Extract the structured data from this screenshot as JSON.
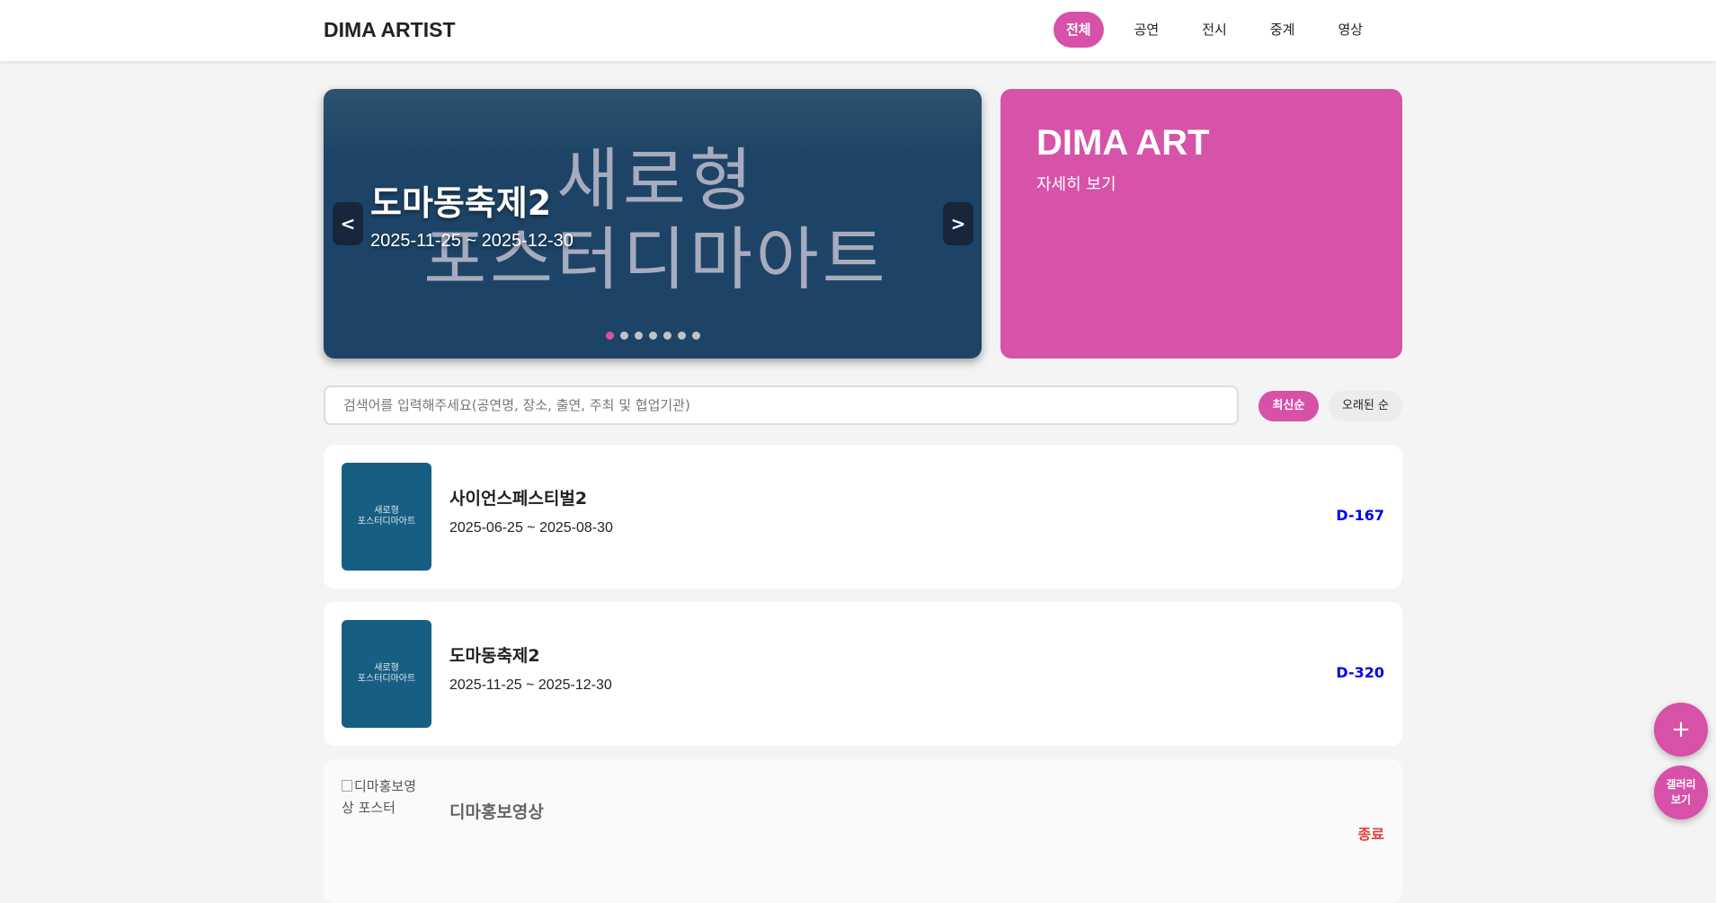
{
  "header": {
    "logo": "DIMA ARTIST",
    "nav": [
      "전체",
      "공연",
      "전시",
      "중계",
      "영상"
    ]
  },
  "hero": {
    "poster_text": "새로형\n포스터디마아트",
    "title": "도마동축제2",
    "date": "2025-11-25 ~ 2025-12-30",
    "prev": "<",
    "next": ">",
    "slide_count": 7,
    "active_slide": 1
  },
  "promo": {
    "title": "DIMA ART",
    "link": "자세히 보기"
  },
  "search": {
    "placeholder": "검색어를 입력해주세요(공연명, 장소, 출연, 주최 및 협업기관)"
  },
  "sort": {
    "latest": "최신순",
    "oldest": "오래된 순"
  },
  "list": [
    {
      "thumb_text": "새로형\n포스터디마아트",
      "title": "사이언스페스티벌2",
      "date": "2025-06-25 ~ 2025-08-30",
      "badge": "D-167"
    },
    {
      "thumb_text": "새로형\n포스터디마아트",
      "title": "도마동축제2",
      "date": "2025-11-25 ~ 2025-12-30",
      "badge": "D-320"
    },
    {
      "alt_text": "디마홍보영상 포스터",
      "title": "디마홍보영상",
      "badge": "종료"
    }
  ],
  "fab": {
    "add": "+",
    "gallery": "갤러리\n보기"
  },
  "colors": {
    "accent": "#d651a7",
    "hero_bg": "#1d4466",
    "thumb_bg": "#175f82",
    "dday": "#0000ee",
    "ended": "#e23b3b"
  }
}
